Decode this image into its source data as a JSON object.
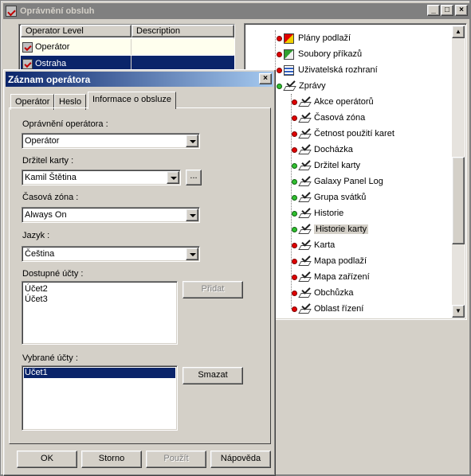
{
  "bg_window": {
    "title": "Oprávnění obsluh",
    "minimize": "_",
    "maximize": "□",
    "close": "×",
    "columns": [
      "Operator Level",
      "Description"
    ],
    "levels": [
      {
        "name": "Operátor",
        "description": ""
      },
      {
        "name": "Ostraha",
        "description": ""
      }
    ]
  },
  "tree": {
    "items": [
      {
        "label": "Plány podlaží",
        "dot": "red",
        "icon": "floorplan-icon",
        "level": 0
      },
      {
        "label": "Soubory příkazů",
        "dot": "red",
        "icon": "command-file-icon",
        "level": 0
      },
      {
        "label": "Uživatelská rozhraní",
        "dot": "red",
        "icon": "user-interface-icon",
        "level": 0
      },
      {
        "label": "Zprávy",
        "dot": "green",
        "icon": "check-icon",
        "level": 0
      },
      {
        "label": "Akce operátorů",
        "dot": "red",
        "icon": "check-icon",
        "level": 1
      },
      {
        "label": "Časová zóna",
        "dot": "red",
        "icon": "check-icon",
        "level": 1
      },
      {
        "label": "Četnost použití karet",
        "dot": "red",
        "icon": "check-icon",
        "level": 1
      },
      {
        "label": "Docházka",
        "dot": "red",
        "icon": "check-icon",
        "level": 1
      },
      {
        "label": "Držitel karty",
        "dot": "green",
        "icon": "check-icon",
        "level": 1
      },
      {
        "label": "Galaxy Panel Log",
        "dot": "green",
        "icon": "check-icon",
        "level": 1
      },
      {
        "label": "Grupa svátků",
        "dot": "green",
        "icon": "check-icon",
        "level": 1
      },
      {
        "label": "Historie",
        "dot": "green",
        "icon": "check-icon",
        "level": 1
      },
      {
        "label": "Historie karty",
        "dot": "green",
        "icon": "check-icon",
        "level": 1,
        "selected": true
      },
      {
        "label": "Karta",
        "dot": "red",
        "icon": "check-icon",
        "level": 1
      },
      {
        "label": "Mapa podlaží",
        "dot": "red",
        "icon": "check-icon",
        "level": 1
      },
      {
        "label": "Mapa zařízení",
        "dot": "red",
        "icon": "check-icon",
        "level": 1
      },
      {
        "label": "Obchůzka",
        "dot": "red",
        "icon": "check-icon",
        "level": 1
      },
      {
        "label": "Oblast řízení",
        "dot": "red",
        "icon": "check-icon",
        "level": 1
      }
    ]
  },
  "dialog": {
    "title": "Záznam operátora",
    "close": "×",
    "tabs": [
      "Operátor",
      "Heslo",
      "Informace o obsluze"
    ],
    "active_tab": "Informace o obsluze",
    "permission_label": "Oprávnění operátora :",
    "permission_value": "Operátor",
    "cardholder_label": "Držitel karty :",
    "cardholder_value": "Kamil Štětina",
    "browse_label": "...",
    "timezone_label": "Časová zóna :",
    "timezone_value": "Always On",
    "language_label": "Jazyk :",
    "language_value": "Čeština",
    "available_label": "Dostupné účty :",
    "available_accounts": [
      "Účet2",
      "Účet3"
    ],
    "add_label": "Přidat",
    "selected_label": "Vybrané účty :",
    "selected_accounts": [
      "Účet1"
    ],
    "remove_label": "Smazat",
    "ok_label": "OK",
    "cancel_label": "Storno",
    "apply_label": "Použít",
    "help_label": "Nápověda"
  },
  "colors": {
    "dialog_face": "#d4d0c8",
    "title_active": "#0a246a",
    "selection": "#0a246a",
    "dot_red": "#e00000",
    "dot_green": "#30c030"
  }
}
